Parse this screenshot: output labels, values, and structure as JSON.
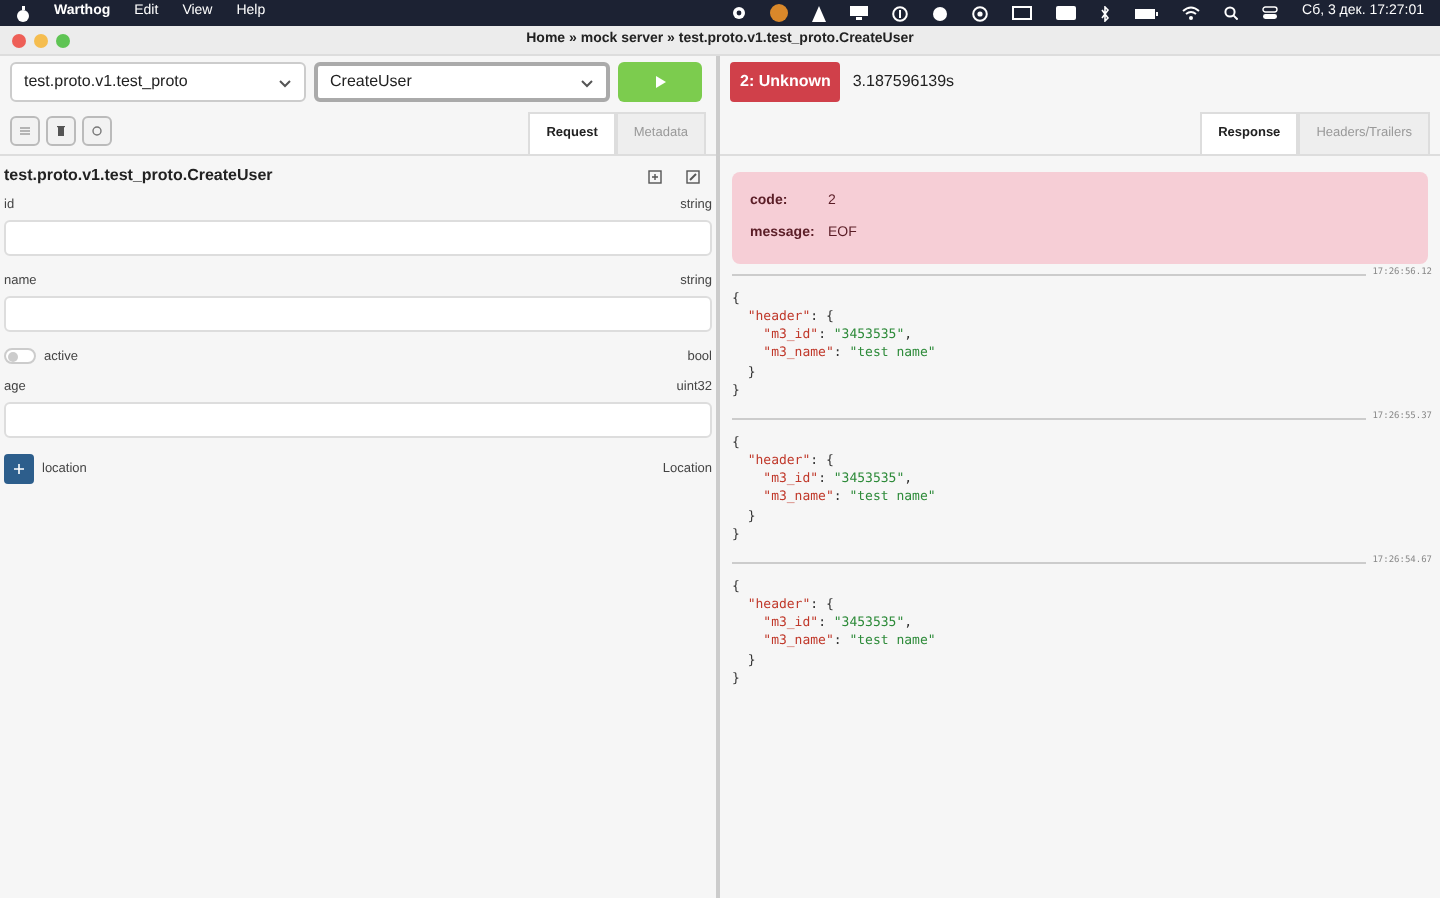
{
  "menu_bar": {
    "app": "Warthog",
    "items": [
      "Edit",
      "View",
      "Help"
    ],
    "clock": "Сб, 3 дек.  17:27:01"
  },
  "window": {
    "title": "Home » mock server » test.proto.v1.test_proto.CreateUser"
  },
  "request": {
    "service": "test.proto.v1.test_proto",
    "method": "CreateUser",
    "tabs": [
      {
        "label": "Request",
        "selected": true
      },
      {
        "label": "Metadata",
        "selected": false
      }
    ],
    "message": "test.proto.v1.test_proto.CreateUser",
    "fields": [
      {
        "kind": "text",
        "name": "id",
        "type": "string"
      },
      {
        "kind": "text",
        "name": "name",
        "type": "string"
      },
      {
        "kind": "toggle",
        "name": "active",
        "type": "bool",
        "on": false
      },
      {
        "kind": "text",
        "name": "age",
        "type": "uint32"
      },
      {
        "kind": "message",
        "name": "location",
        "type": "Location"
      }
    ]
  },
  "response": {
    "status": "2: Unknown",
    "duration": "3.187596139s",
    "tabs": [
      {
        "label": "Response",
        "selected": true
      },
      {
        "label": "Headers/Trailers",
        "selected": false
      }
    ],
    "error": {
      "code_label": "code:",
      "code": "2",
      "message_label": "message:",
      "message": "EOF"
    },
    "entries": [
      {
        "time": "17:26:56.12",
        "body": "{\n  \"header\": {\n    \"m3_id\": \"3453535\",\n    \"m3_name\": \"test name\"\n  }\n}"
      },
      {
        "time": "17:26:55.37",
        "body": "{\n  \"header\": {\n    \"m3_id\": \"3453535\",\n    \"m3_name\": \"test name\"\n  }\n}"
      },
      {
        "time": "17:26:54.67",
        "body": "{\n  \"header\": {\n    \"m3_id\": \"3453535\",\n    \"m3_name\": \"test name\"\n  }\n}"
      }
    ]
  }
}
